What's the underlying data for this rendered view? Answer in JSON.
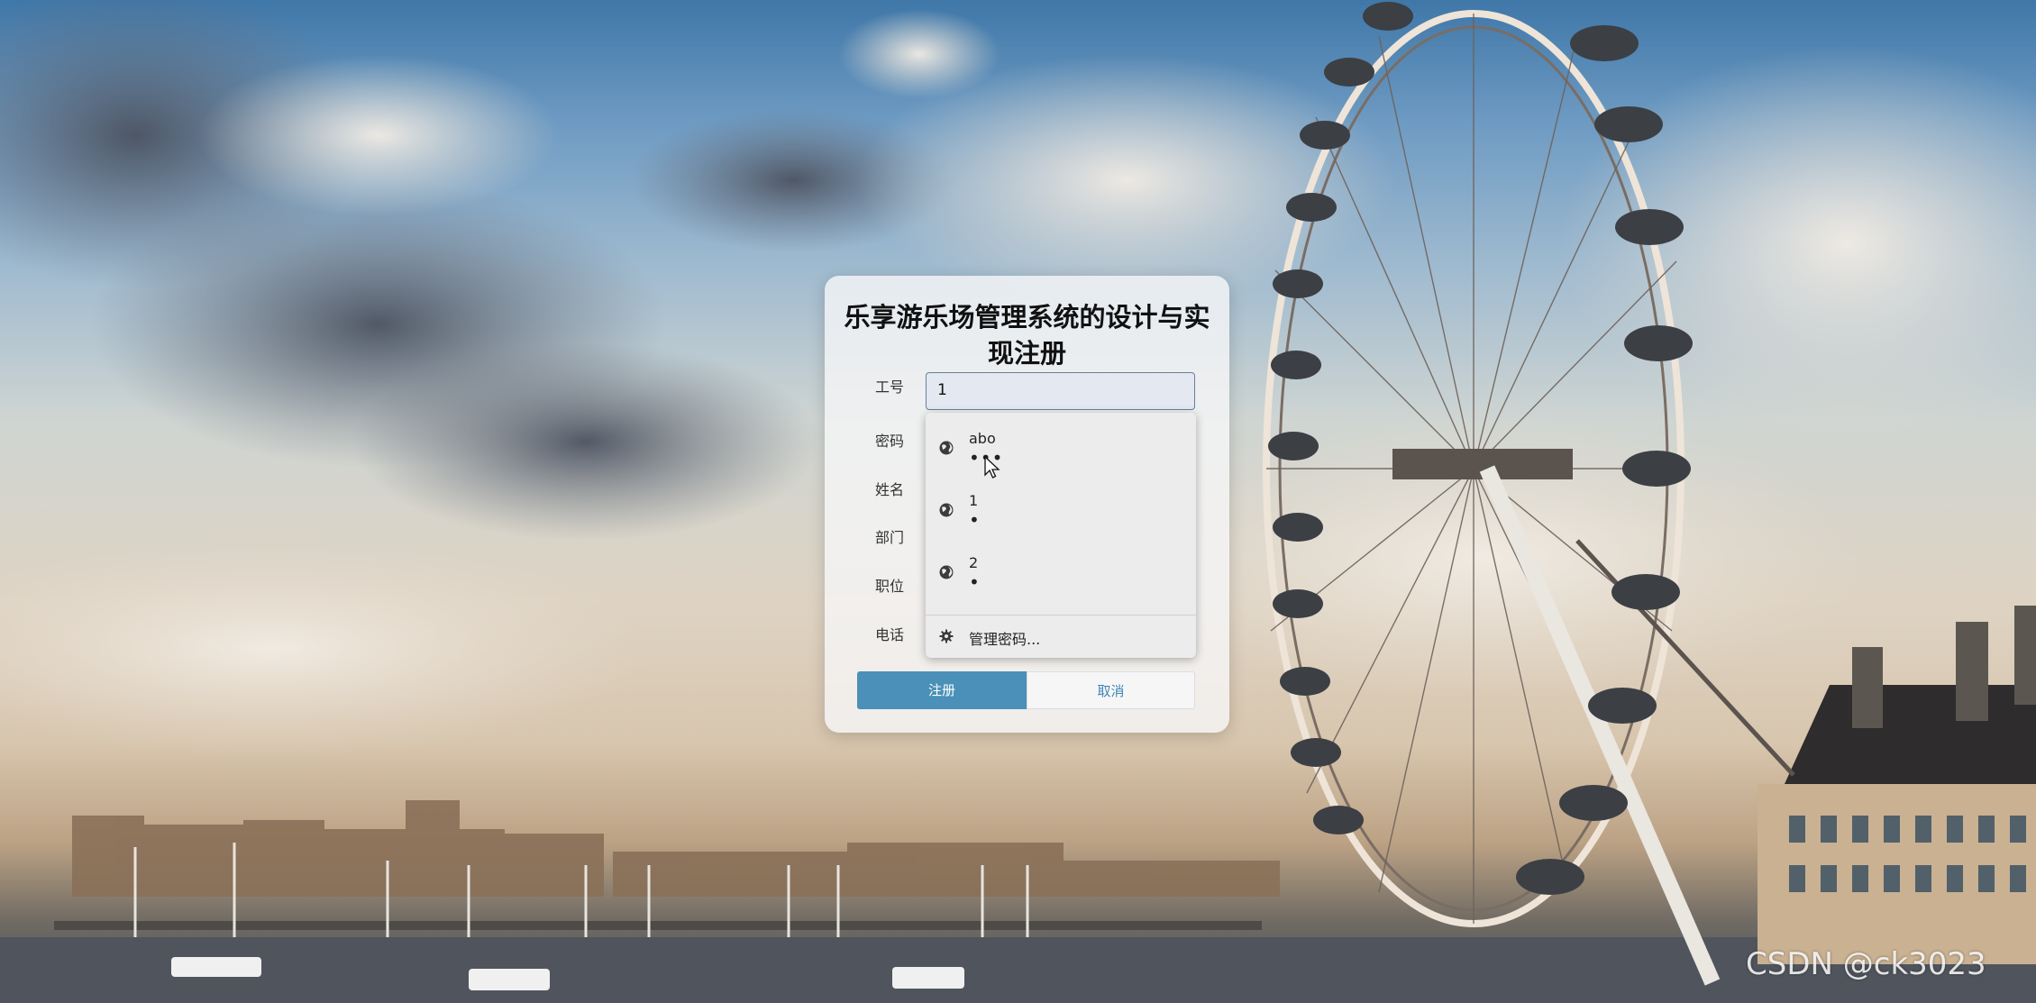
{
  "page": {
    "title": "乐享游乐场管理系统的设计与实现注册"
  },
  "form": {
    "fields": [
      {
        "label": "工号",
        "value": "1"
      },
      {
        "label": "密码",
        "value": ""
      },
      {
        "label": "姓名",
        "value": ""
      },
      {
        "label": "部门",
        "value": ""
      },
      {
        "label": "职位",
        "value": ""
      },
      {
        "label": "电话",
        "value": ""
      }
    ],
    "register_label": "注册",
    "cancel_label": "取消"
  },
  "autofill": {
    "items": [
      {
        "username": "abo",
        "password_mask": "•••",
        "icon": "globe-icon"
      },
      {
        "username": "1",
        "password_mask": "•",
        "icon": "globe-icon"
      },
      {
        "username": "2",
        "password_mask": "•",
        "icon": "globe-icon"
      }
    ],
    "manage_label": "管理密码...",
    "manage_icon": "gear-icon"
  },
  "watermark": "CSDN @ck3023",
  "colors": {
    "primary": "#4a90b8",
    "cancel_text": "#3f86b3"
  }
}
